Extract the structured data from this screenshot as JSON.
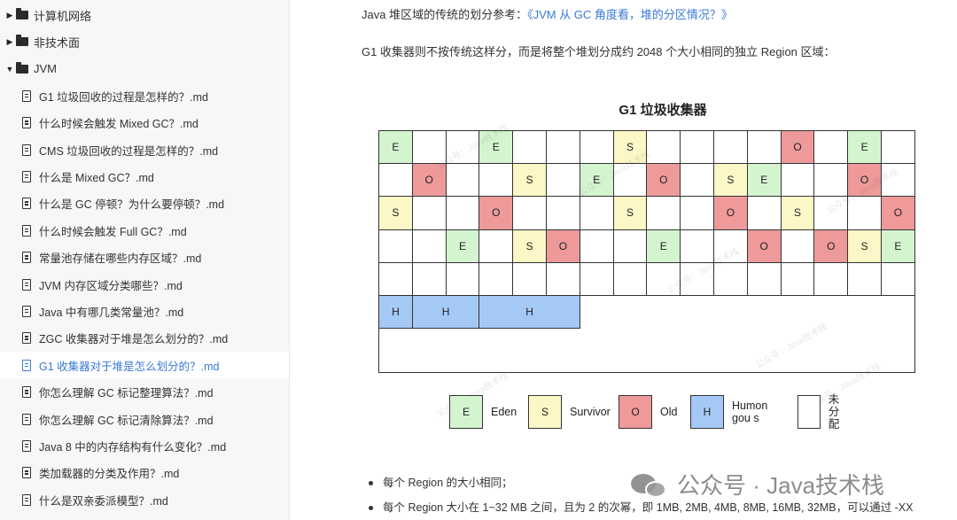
{
  "sidebar": {
    "folders": [
      {
        "label": "计算机网络",
        "expanded": false
      },
      {
        "label": "非技术面",
        "expanded": false
      },
      {
        "label": "JVM",
        "expanded": true
      }
    ],
    "files": [
      "G1 垃圾回收的过程是怎样的？.md",
      "什么时候会触发 Mixed GC？.md",
      "CMS 垃圾回收的过程是怎样的？.md",
      "什么是 Mixed GC？.md",
      "什么是 GC 停顿？为什么要停顿？.md",
      "什么时候会触发 Full GC？.md",
      "常量池存储在哪些内存区域？.md",
      "JVM 内存区域分类哪些？.md",
      "Java 中有哪几类常量池？.md",
      "ZGC 收集器对于堆是怎么划分的？.md",
      "G1 收集器对于堆是怎么划分的？.md",
      "你怎么理解 GC 标记整理算法？.md",
      "你怎么理解 GC 标记清除算法？.md",
      "Java 8 中的内存结构有什么变化？.md",
      "类加载器的分类及作用？.md",
      "什么是双亲委派模型？.md"
    ],
    "active_file_index": 10
  },
  "main": {
    "para1_prefix": "Java 堆区域的传统的划分参考：",
    "para1_link": "《JVM 从 GC 角度看，堆的分区情况？》",
    "para2": "G1 收集器则不按传统这样分，而是将整个堆划分成约 2048 个大小相同的独立 Region 区域：",
    "figure": {
      "title": "G1 垃圾收集器",
      "rows": [
        [
          "E",
          "",
          "",
          "E",
          "",
          "",
          "",
          "S",
          "",
          "",
          "",
          "",
          "O",
          "",
          "E",
          ""
        ],
        [
          "",
          "O",
          "",
          "",
          "S",
          "",
          "E",
          "",
          "O",
          "",
          "S",
          "E",
          "",
          "",
          "O",
          ""
        ],
        [
          "S",
          "",
          "",
          "O",
          "",
          "",
          "",
          "S",
          "",
          "",
          "O",
          "",
          "S",
          "",
          "",
          "O"
        ],
        [
          "",
          "",
          "E",
          "",
          "S",
          "O",
          "",
          "",
          "E",
          "",
          "",
          "O",
          "",
          "O",
          "S",
          "E"
        ],
        [
          "",
          "",
          "",
          "",
          "",
          "",
          "",
          "",
          "",
          "",
          "",
          "",
          "",
          "",
          "",
          ""
        ]
      ],
      "humongous": [
        {
          "label": "H",
          "span": 1
        },
        {
          "label": "H",
          "span": 2
        },
        {
          "label": "H",
          "span": 3
        }
      ],
      "legend": [
        {
          "key": "E",
          "label": "Eden",
          "color": "#d4f4d0"
        },
        {
          "key": "S",
          "label": "Survivor",
          "color": "#fbf7c6"
        },
        {
          "key": "O",
          "label": "Old",
          "color": "#ee9a9a"
        },
        {
          "key": "H",
          "label": "Humongou s",
          "color": "#a5c9f5"
        },
        {
          "key": "",
          "label": "未分配",
          "color": "#ffffff"
        }
      ],
      "colors": {
        "E": "#d4f4d0",
        "S": "#fbf7c6",
        "O": "#ee9a9a",
        "H": "#a5c9f5"
      },
      "watermark_text": "公众号：Java技术栈"
    },
    "bullets": [
      "每个 Region 的大小相同；",
      "每个 Region 大小在 1~32 MB 之间，且为 2 的次幂，即 1MB, 2MB, 4MB, 8MB, 16MB, 32MB，可以通过 -XX"
    ],
    "wechat_watermark": "公众号 · Java技术栈"
  }
}
